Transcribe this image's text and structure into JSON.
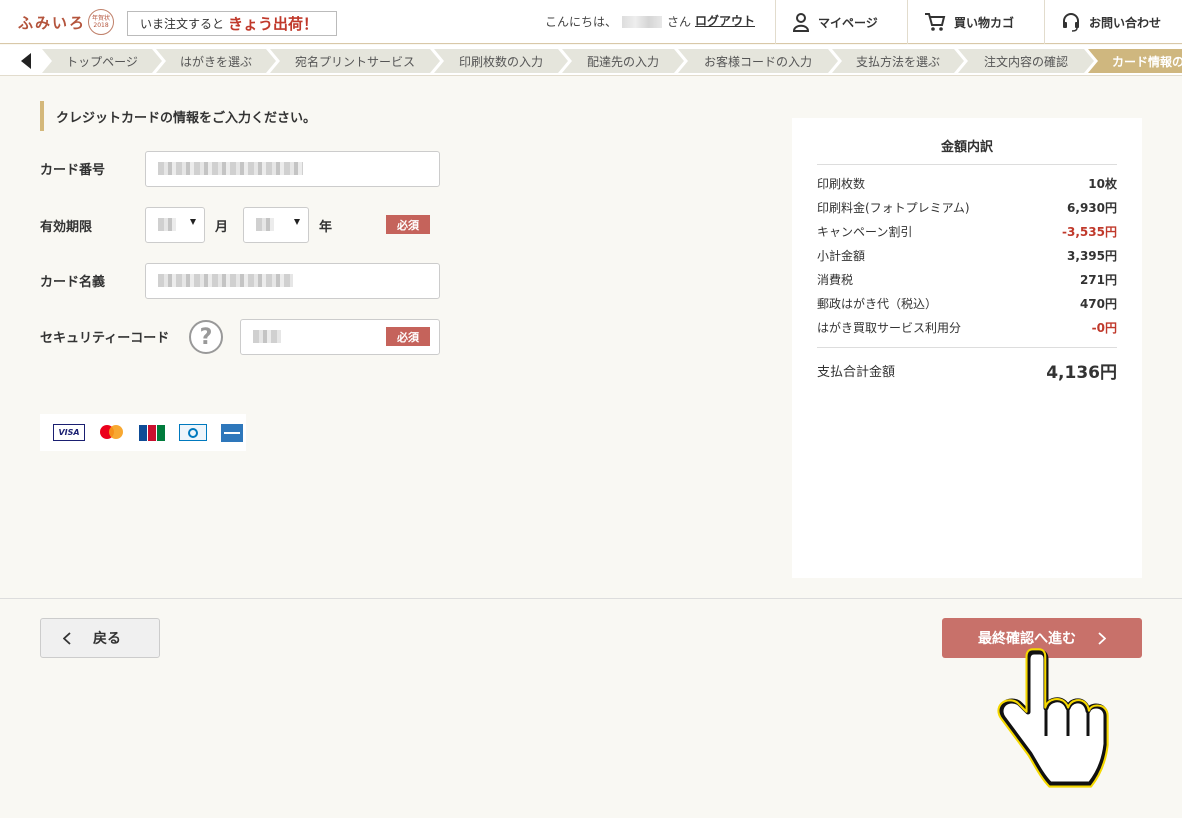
{
  "header": {
    "logo": "ふみいろ",
    "logo_seal": "年賀状 2018",
    "promo_prefix": "いま注文すると",
    "promo_highlight": "きょう出荷！",
    "greeting_prefix": "こんにちは、",
    "greeting_suffix": "さん",
    "logout": "ログアウト",
    "nav": [
      {
        "label": "マイページ",
        "icon": "person-icon"
      },
      {
        "label": "買い物カゴ",
        "icon": "cart-icon"
      },
      {
        "label": "お問い合わせ",
        "icon": "headset-icon"
      }
    ]
  },
  "breadcrumb": {
    "items": [
      "トップページ",
      "はがきを選ぶ",
      "宛名プリントサービス",
      "印刷枚数の入力",
      "配達先の入力",
      "お客様コードの入力",
      "支払方法を選ぶ",
      "注文内容の確認",
      "カード情報の"
    ]
  },
  "form": {
    "title": "クレジットカードの情報をご入力ください。",
    "card_number_label": "カード番号",
    "expiry_label": "有効期限",
    "month_unit": "月",
    "year_unit": "年",
    "required": "必須",
    "card_name_label": "カード名義",
    "security_label": "セキュリティーコード",
    "help": "?"
  },
  "card_brands": [
    "VISA",
    "mastercard",
    "JCB",
    "Diners Club",
    "AMEX"
  ],
  "summary": {
    "title": "金額内訳",
    "rows": [
      {
        "label": "印刷枚数",
        "value": "10枚",
        "negative": false
      },
      {
        "label": "印刷料金(フォトプレミアム)",
        "value": "6,930円",
        "negative": false
      },
      {
        "label": "キャンペーン割引",
        "value": "-3,535円",
        "negative": true
      },
      {
        "label": "小計金額",
        "value": "3,395円",
        "negative": false
      },
      {
        "label": "消費税",
        "value": "271円",
        "negative": false
      },
      {
        "label": "郵政はがき代（税込）",
        "value": "470円",
        "negative": false
      },
      {
        "label": "はがき買取サービス利用分",
        "value": "-0円",
        "negative": true
      }
    ],
    "total_label": "支払合計金額",
    "total_value": "4,136円"
  },
  "footer": {
    "back": "戻る",
    "next": "最終確認へ進む"
  },
  "colors": {
    "accent_gold": "#cfb77f",
    "primary_button": "#c8716a",
    "required_badge": "#c5635b",
    "negative_value": "#c0392b"
  }
}
